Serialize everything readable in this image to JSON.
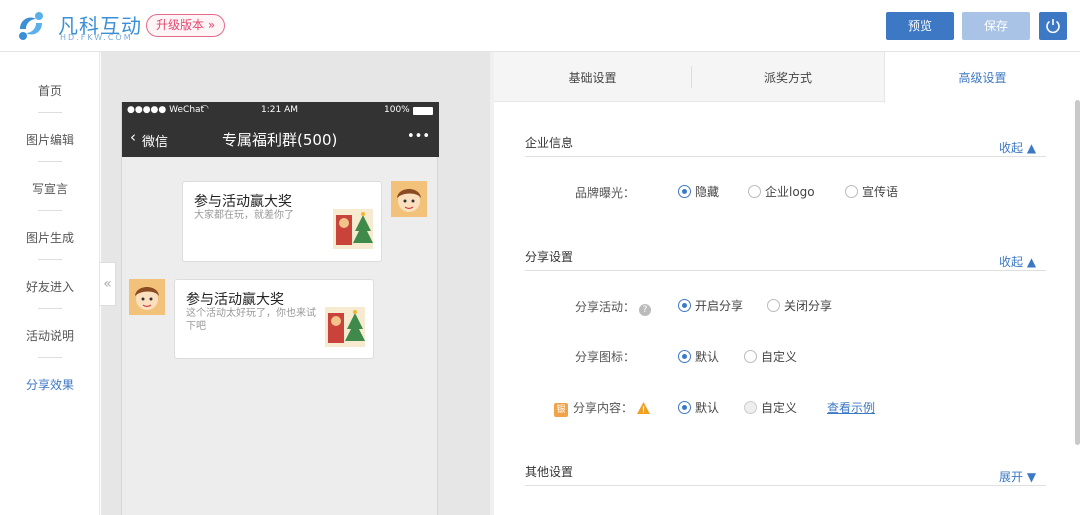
{
  "header": {
    "logo_text": "凡科互动",
    "logo_sub": "HD.FKW.COM",
    "upgrade_label": "升级版本 »",
    "preview_label": "预览",
    "save_label": "保存"
  },
  "nav": {
    "items": [
      {
        "label": "首页"
      },
      {
        "label": "图片编辑"
      },
      {
        "label": "写宣言"
      },
      {
        "label": "图片生成"
      },
      {
        "label": "好友进入"
      },
      {
        "label": "活动说明"
      },
      {
        "label": "分享效果"
      }
    ],
    "active_index": 6
  },
  "phone": {
    "signal": "●●●●● WeChat",
    "time": "1:21 AM",
    "battery": "100%",
    "back_label": "微信",
    "chat_title": "专属福利群(500)",
    "more": "•••",
    "messages": [
      {
        "title": "参与活动赢大奖",
        "desc": "大家都在玩，就差你了"
      },
      {
        "title": "参与活动赢大奖",
        "desc": "这个活动太好玩了，你也来试下吧"
      }
    ]
  },
  "tabs": [
    {
      "label": "基础设置"
    },
    {
      "label": "派奖方式"
    },
    {
      "label": "高级设置"
    }
  ],
  "sections": {
    "company": {
      "title": "企业信息",
      "toggle": "收起 ▲",
      "brand_label": "品牌曝光：",
      "options": [
        "隐藏",
        "企业logo",
        "宣传语"
      ]
    },
    "share": {
      "title": "分享设置",
      "toggle": "收起 ▲",
      "activity_label": "分享活动：",
      "activity_options": [
        "开启分享",
        "关闭分享"
      ],
      "icon_label": "分享图标：",
      "icon_options": [
        "默认",
        "自定义"
      ],
      "content_badge": "银",
      "content_label": "分享内容：",
      "content_options": [
        "默认",
        "自定义"
      ],
      "example_link": "查看示例"
    },
    "other": {
      "title": "其他设置",
      "toggle": "展开 ▼"
    }
  },
  "colors": {
    "accent": "#3d78c5",
    "upgrade": "#e3486e"
  }
}
